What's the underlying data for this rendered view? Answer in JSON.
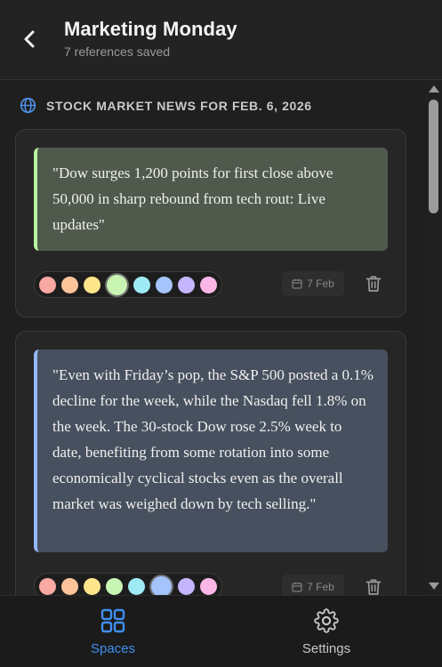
{
  "header": {
    "title": "Marketing Monday",
    "subtitle": "7 references saved"
  },
  "section": {
    "title": "STOCK MARKET NEWS FOR FEB. 6, 2026"
  },
  "palette": [
    "#f9a8a3",
    "#fdc49a",
    "#fde68a",
    "#c8f5b4",
    "#9eeaf5",
    "#a5c4fb",
    "#c4b5fd",
    "#f9b6e6"
  ],
  "cards": [
    {
      "quote": "\"Dow surges 1,200 points for first close above 50,000 in sharp rebound from tech rout: Live updates\"",
      "accent": "#b7f3a0",
      "background": "#505a4c",
      "selected_color_index": 3,
      "date": "7 Feb"
    },
    {
      "quote": "\"Even with Friday’s pop, the S&P 500 posted a 0.1% decline for the week, while the Nasdaq fell 1.8% on the week. The 30-stock Dow rose 2.5% week to date, benefiting from some rotation into some economically cyclical stocks even as the overall market was weighed down by tech selling.\"",
      "accent": "#93b8f5",
      "background": "#47505e",
      "selected_color_index": 5,
      "date": "7 Feb"
    }
  ],
  "nav": {
    "spaces_label": "Spaces",
    "settings_label": "Settings",
    "active_color": "#3f8ef0",
    "inactive_color": "#c8c8c8"
  }
}
